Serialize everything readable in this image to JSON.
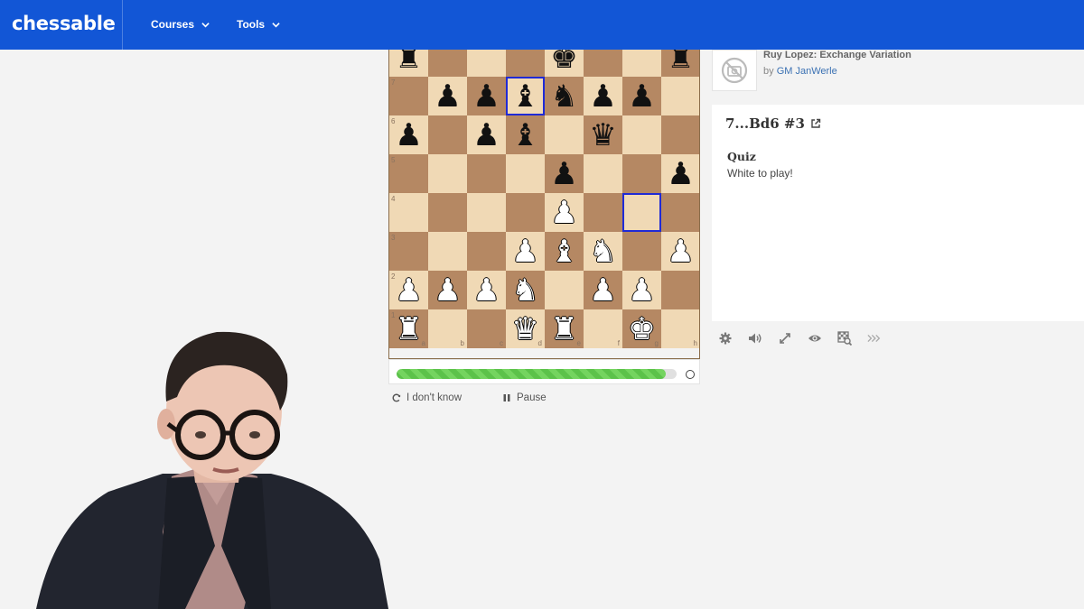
{
  "nav": {
    "logo": "chessable",
    "items": [
      {
        "label": "Courses"
      },
      {
        "label": "Tools"
      }
    ]
  },
  "board": {
    "ranks": [
      "8",
      "7",
      "6",
      "5",
      "4",
      "3",
      "2",
      "1"
    ],
    "files": [
      "a",
      "b",
      "c",
      "d",
      "e",
      "f",
      "g",
      "h"
    ],
    "rows": [
      [
        "br",
        "",
        "",
        "",
        "bk",
        "",
        "",
        "br"
      ],
      [
        "",
        "bp",
        "bp",
        "bb",
        "bn",
        "bp",
        "bp",
        ""
      ],
      [
        "bp",
        "",
        "bp",
        "bb",
        "",
        "bq",
        "",
        ""
      ],
      [
        "",
        "",
        "",
        "",
        "bp",
        "",
        "",
        "bp"
      ],
      [
        "",
        "",
        "",
        "",
        "wp",
        "",
        "",
        ""
      ],
      [
        "",
        "",
        "",
        "wp",
        "wb",
        "wn",
        "",
        "wp"
      ],
      [
        "wp",
        "wp",
        "wp",
        "wn",
        "",
        "wp",
        "wp",
        ""
      ],
      [
        "wr",
        "",
        "",
        "wq",
        "wr",
        "",
        "wk",
        ""
      ]
    ],
    "highlights": [
      "d7",
      "g4"
    ]
  },
  "progress": {
    "fraction": 0.96
  },
  "actions": {
    "dont_know": "I don't know",
    "pause": "Pause"
  },
  "course": {
    "title": "Ruy Lopez: Exchange Variation",
    "by": "by",
    "author": "GM JanWerle"
  },
  "move": {
    "title": "7...Bd6 #3",
    "quiz_label": "Quiz",
    "quiz_text": "White to play!"
  },
  "toolbar_icons": [
    "gear-icon",
    "volume-icon",
    "expand-icon",
    "eye-icon",
    "board-analysis-icon",
    "fast-forward-icon"
  ],
  "colors": {
    "nav": "#1256d6",
    "light_square": "#f0d9b5",
    "dark_square": "#b58863",
    "highlight": "#1f2ad6",
    "progress": "#5cc24a"
  }
}
